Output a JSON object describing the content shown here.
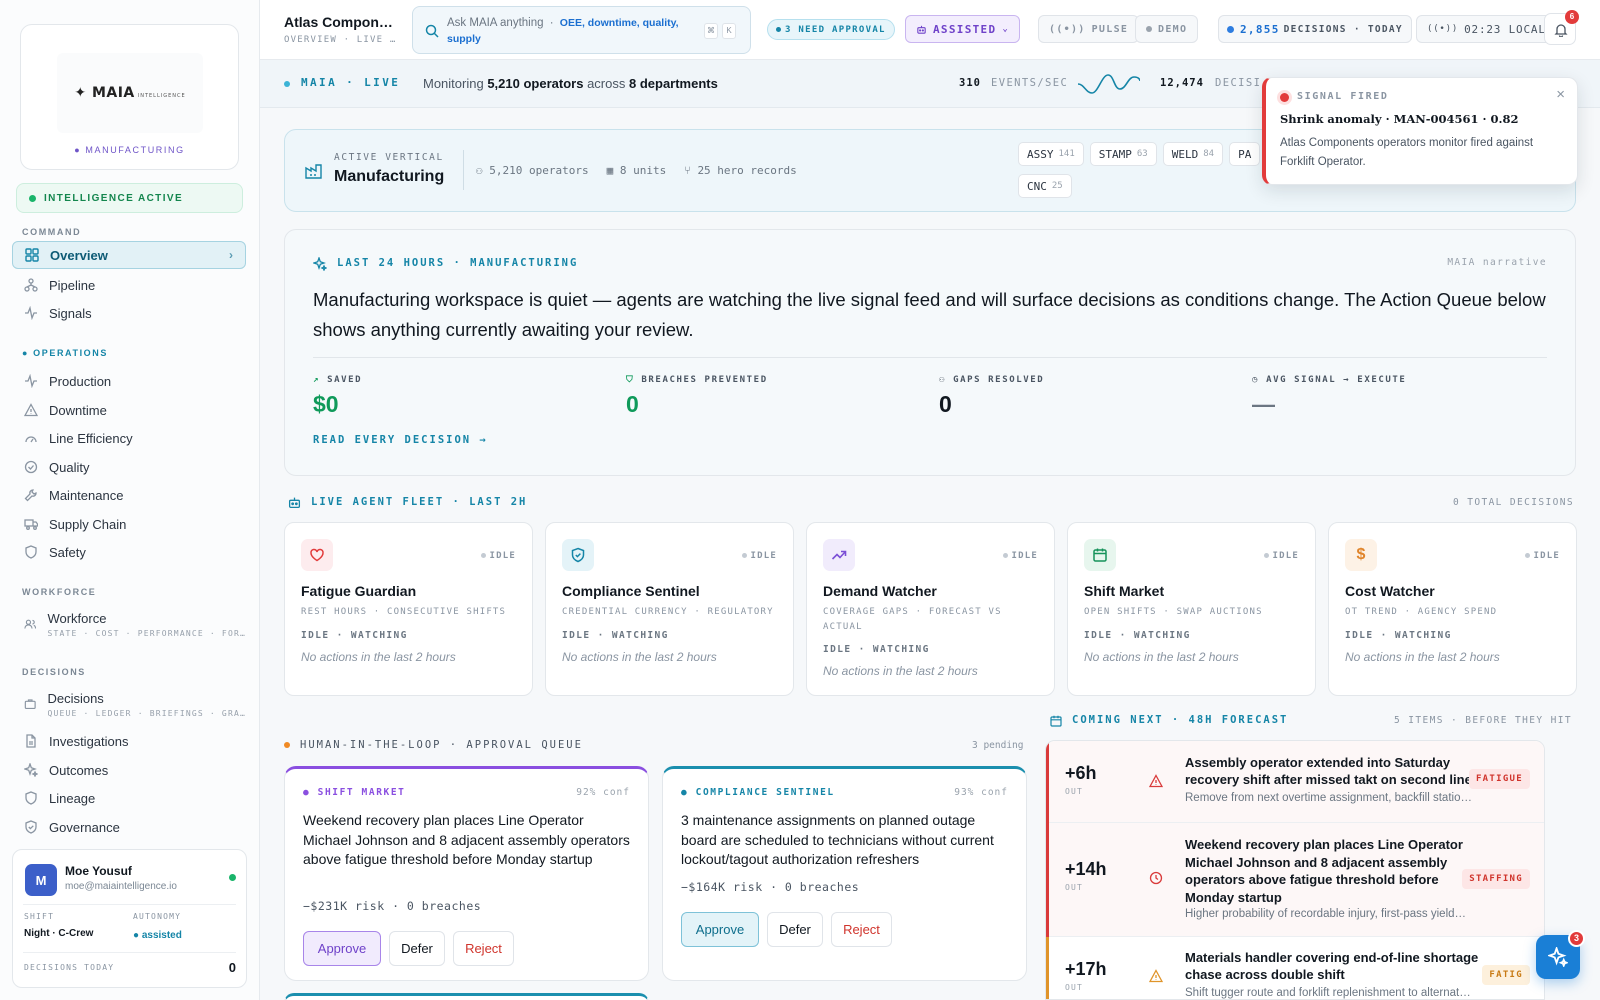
{
  "brand": {
    "logo_text": "MAIA",
    "logo_sub": "INTELLIGENCE",
    "vertical_tag": "MANUFACTURING",
    "status": "INTELLIGENCE ACTIVE"
  },
  "sidebar": {
    "command_label": "COMMAND",
    "command_items": [
      "Overview",
      "Pipeline",
      "Signals"
    ],
    "operations_label": "OPERATIONS",
    "operations_items": [
      "Production",
      "Downtime",
      "Line Efficiency",
      "Quality",
      "Maintenance",
      "Supply Chain",
      "Safety"
    ],
    "workforce_label": "WORKFORCE",
    "workforce_item": {
      "label": "Workforce",
      "sub": "STATE · COST · PERFORMANCE · FOR…"
    },
    "decisions_label": "DECISIONS",
    "decisions_item": {
      "label": "Decisions",
      "sub": "QUEUE · LEDGER · BRIEFINGS · GRA…"
    },
    "decision_items": [
      "Investigations",
      "Outcomes",
      "Lineage",
      "Governance"
    ]
  },
  "user": {
    "initial": "M",
    "name": "Moe Yousuf",
    "email": "moe@maiaintelligence.io",
    "shift_label": "SHIFT",
    "shift_value": "Night · C-Crew",
    "autonomy_label": "AUTONOMY",
    "autonomy_value": "assisted",
    "decisions_label": "DECISIONS TODAY",
    "decisions_value": "0"
  },
  "header": {
    "title": "Atlas Compon…",
    "breadcrumb": "OVERVIEW · LIVE …",
    "search_placeholder": "Ask MAIA anything",
    "search_hint_sep": "·",
    "search_hint": "OEE, downtime, quality, supply",
    "kbd1": "⌘",
    "kbd2": "K",
    "approval_badge": "3 NEED APPROVAL",
    "mode": "ASSISTED",
    "pulse": "PULSE",
    "demo": "DEMO",
    "decisions_count": "2,855",
    "decisions_label": "DECISIONS · TODAY",
    "time": "02:23 LOCAL",
    "notif_count": "6"
  },
  "strip": {
    "live_label": "MAIA · LIVE",
    "monitoring_pre": "Monitoring",
    "operators": "5,210 operators",
    "across": "across",
    "departments": "8 departments",
    "events_value": "310",
    "events_label": "EVENTS/SEC",
    "decisions_value": "12,474",
    "decisions_label": "DECISI"
  },
  "toast": {
    "label": "SIGNAL FIRED",
    "title": "Shrink anomaly · MAN-004561 · 0.82",
    "body": "Atlas Components operators monitor fired against Forklift Operator."
  },
  "vertical": {
    "label": "ACTIVE VERTICAL",
    "name": "Manufacturing",
    "operators": "5,210 operators",
    "units": "8 units",
    "hero": "25 hero records",
    "chips": [
      {
        "code": "ASSY",
        "count": "141"
      },
      {
        "code": "STAMP",
        "count": "63"
      },
      {
        "code": "WELD",
        "count": "84"
      },
      {
        "code": "PA",
        "count": ""
      },
      {
        "code": "CNC",
        "count": "25"
      }
    ]
  },
  "narrative": {
    "label": "LAST 24 HOURS · MANUFACTURING",
    "source": "MAIA narrative",
    "text": "Manufacturing workspace is quiet — agents are watching the live signal feed and will surface decisions as conditions change. The Action Queue below shows anything currently awaiting your review.",
    "stats": [
      {
        "label": "SAVED",
        "value": "$0",
        "color": "#0f9a5a"
      },
      {
        "label": "BREACHES PREVENTED",
        "value": "0",
        "color": "#0f9a5a"
      },
      {
        "label": "GAPS RESOLVED",
        "value": "0",
        "color": "#111820"
      },
      {
        "label": "AVG SIGNAL → EXECUTE",
        "value": "—",
        "color": "#6b7682"
      }
    ],
    "link": "READ EVERY DECISION →"
  },
  "fleet": {
    "label": "LIVE AGENT FLEET · LAST 2H",
    "total": "0 TOTAL DECISIONS",
    "agents": [
      {
        "name": "Fatigue Guardian",
        "desc": "REST HOURS · CONSECUTIVE SHIFTS",
        "status": "IDLE",
        "watch": "IDLE · WATCHING",
        "none": "No actions in the last 2 hours",
        "icon": "heart-icon"
      },
      {
        "name": "Compliance Sentinel",
        "desc": "CREDENTIAL CURRENCY · REGULATORY",
        "status": "IDLE",
        "watch": "IDLE · WATCHING",
        "none": "No actions in the last 2 hours",
        "icon": "shield-icon"
      },
      {
        "name": "Demand Watcher",
        "desc": "COVERAGE GAPS · FORECAST VS ACTUAL",
        "status": "IDLE",
        "watch": "IDLE · WATCHING",
        "none": "No actions in the last 2 hours",
        "icon": "trend-icon"
      },
      {
        "name": "Shift Market",
        "desc": "OPEN SHIFTS · SWAP AUCTIONS",
        "status": "IDLE",
        "watch": "IDLE · WATCHING",
        "none": "No actions in the last 2 hours",
        "icon": "calendar-icon"
      },
      {
        "name": "Cost Watcher",
        "desc": "OT TREND · AGENCY SPEND",
        "status": "IDLE",
        "watch": "IDLE · WATCHING",
        "none": "No actions in the last 2 hours",
        "icon": "dollar-icon"
      }
    ]
  },
  "queue": {
    "label": "HUMAN-IN-THE-LOOP · APPROVAL QUEUE",
    "pending": "3 pending",
    "items": [
      {
        "agent": "SHIFT MARKET",
        "conf": "92% conf",
        "text": "Weekend recovery plan places Line Operator Michael Johnson and 8 adjacent assembly operators above fatigue threshold before Monday startup",
        "risk": "−$231K risk · 0 breaches",
        "accent": "#8a4fe0"
      },
      {
        "agent": "COMPLIANCE SENTINEL",
        "conf": "93% conf",
        "text": "3 maintenance assignments on planned outage board are scheduled to technicians without current lockout/tagout authorization refreshers",
        "risk": "−$164K risk · 0 breaches",
        "accent": "#1b8fae"
      }
    ],
    "approve": "Approve",
    "defer": "Defer",
    "reject": "Reject"
  },
  "forecast": {
    "label": "COMING NEXT · 48H FORECAST",
    "meta": "5 ITEMS · BEFORE THEY HIT",
    "items": [
      {
        "eta": "+6h",
        "out": "OUT",
        "title": "Assembly operator extended into Saturday recovery shift after missed takt on second line",
        "sub": "Remove from next overtime assignment, backfill statio…",
        "tag": "FATIGUE",
        "icon": "warning-icon",
        "color": "#d93a3a"
      },
      {
        "eta": "+14h",
        "out": "OUT",
        "title": "Weekend recovery plan places Line Operator Michael Johnson and 8 adjacent assembly operators above fatigue threshold before Monday startup",
        "sub": "Higher probability of recordable injury, first-pass yield…",
        "tag": "STAFFING",
        "icon": "clock-icon",
        "color": "#d93a3a"
      },
      {
        "eta": "+17h",
        "out": "OUT",
        "title": "Materials handler covering end-of-line shortage chase across double shift",
        "sub": "Shift tugger route and forklift replenishment to alternat…",
        "tag": "FATIG",
        "icon": "warning-icon",
        "color": "#e0942a"
      }
    ]
  },
  "fab_count": "3"
}
